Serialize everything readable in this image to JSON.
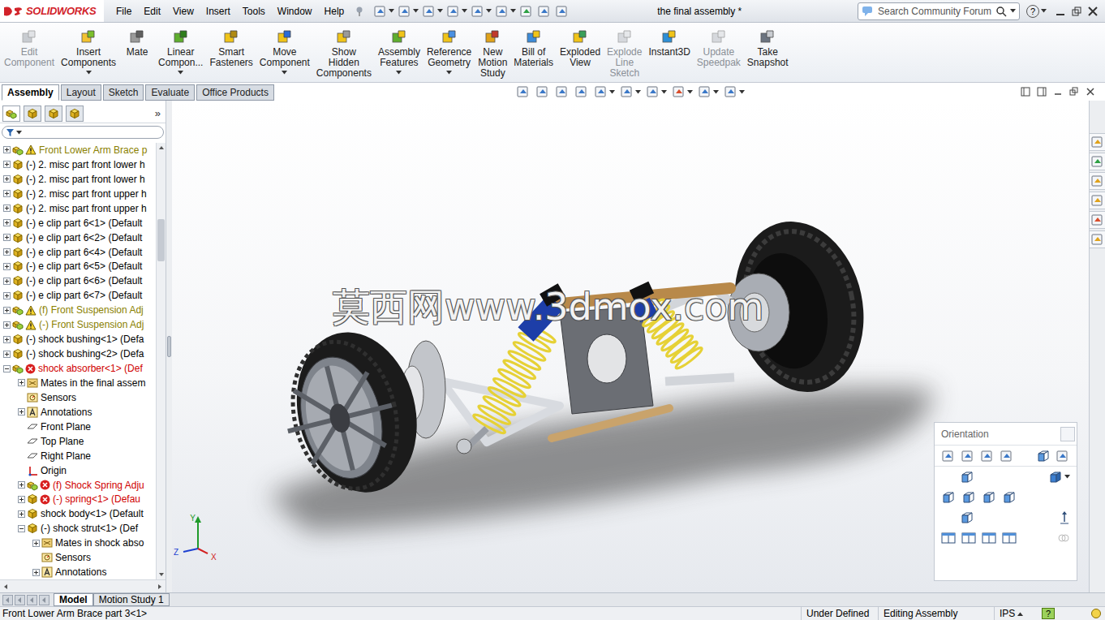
{
  "app": {
    "logo": "SOLIDWORKS",
    "menu": [
      "File",
      "Edit",
      "View",
      "Insert",
      "Tools",
      "Window",
      "Help"
    ],
    "title": "the final assembly *",
    "search": {
      "placeholder": "Search Community Forum"
    },
    "help": "?"
  },
  "command_manager": [
    {
      "lines": [
        "Edit",
        "Component"
      ],
      "disabled": true,
      "dropdown": false
    },
    {
      "lines": [
        "Insert",
        "Components"
      ],
      "disabled": false,
      "dropdown": true
    },
    {
      "lines": [
        "Mate"
      ],
      "disabled": false,
      "dropdown": false
    },
    {
      "lines": [
        "Linear",
        "Compon..."
      ],
      "disabled": false,
      "dropdown": true
    },
    {
      "lines": [
        "Smart",
        "Fasteners"
      ],
      "disabled": false,
      "dropdown": false
    },
    {
      "lines": [
        "Move",
        "Component"
      ],
      "disabled": false,
      "dropdown": true
    },
    {
      "lines": [
        "Show",
        "Hidden",
        "Components"
      ],
      "disabled": false,
      "dropdown": false
    },
    {
      "lines": [
        "Assembly",
        "Features"
      ],
      "disabled": false,
      "dropdown": true
    },
    {
      "lines": [
        "Reference",
        "Geometry"
      ],
      "disabled": false,
      "dropdown": true
    },
    {
      "lines": [
        "New",
        "Motion",
        "Study"
      ],
      "disabled": false,
      "dropdown": false
    },
    {
      "lines": [
        "Bill of",
        "Materials"
      ],
      "disabled": false,
      "dropdown": false
    },
    {
      "lines": [
        "Exploded",
        "View"
      ],
      "disabled": false,
      "dropdown": false
    },
    {
      "lines": [
        "Explode",
        "Line",
        "Sketch"
      ],
      "disabled": true,
      "dropdown": false
    },
    {
      "lines": [
        "Instant3D"
      ],
      "disabled": false,
      "dropdown": false
    },
    {
      "lines": [
        "Update",
        "Speedpak"
      ],
      "disabled": true,
      "dropdown": false
    },
    {
      "lines": [
        "Take",
        "Snapshot"
      ],
      "disabled": false,
      "dropdown": false
    }
  ],
  "command_tabs": [
    {
      "label": "Assembly",
      "selected": true
    },
    {
      "label": "Layout",
      "selected": false
    },
    {
      "label": "Sketch",
      "selected": false
    },
    {
      "label": "Evaluate",
      "selected": false
    },
    {
      "label": "Office Products",
      "selected": false
    }
  ],
  "feature_tree": {
    "more": "»",
    "scroll_position": 0.16,
    "items": [
      {
        "label": "Front Lower Arm Brace p",
        "depth": 0,
        "kind": "assembly",
        "status": "warning",
        "has_children": true,
        "expanded": false
      },
      {
        "label": "(-) 2. misc part front lower h",
        "depth": 0,
        "kind": "part",
        "status": "none",
        "has_children": true,
        "expanded": false
      },
      {
        "label": "(-) 2. misc part front lower h",
        "depth": 0,
        "kind": "part",
        "status": "none",
        "has_children": true,
        "expanded": false
      },
      {
        "label": "(-) 2. misc part front upper h",
        "depth": 0,
        "kind": "part",
        "status": "none",
        "has_children": true,
        "expanded": false
      },
      {
        "label": "(-) 2. misc part front upper h",
        "depth": 0,
        "kind": "part",
        "status": "none",
        "has_children": true,
        "expanded": false
      },
      {
        "label": "(-) e clip part 6<1> (Default",
        "depth": 0,
        "kind": "part",
        "status": "none",
        "has_children": true,
        "expanded": false
      },
      {
        "label": "(-) e clip part 6<2> (Default",
        "depth": 0,
        "kind": "part",
        "status": "none",
        "has_children": true,
        "expanded": false
      },
      {
        "label": "(-) e clip part 6<4> (Default",
        "depth": 0,
        "kind": "part",
        "status": "none",
        "has_children": true,
        "expanded": false
      },
      {
        "label": "(-) e clip part 6<5> (Default",
        "depth": 0,
        "kind": "part",
        "status": "none",
        "has_children": true,
        "expanded": false
      },
      {
        "label": "(-) e clip part 6<6> (Default",
        "depth": 0,
        "kind": "part",
        "status": "none",
        "has_children": true,
        "expanded": false
      },
      {
        "label": "(-) e clip part 6<7> (Default",
        "depth": 0,
        "kind": "part",
        "status": "none",
        "has_children": true,
        "expanded": false
      },
      {
        "label": "(f) Front Suspension Adj",
        "depth": 0,
        "kind": "assembly",
        "status": "warning",
        "has_children": true,
        "expanded": false
      },
      {
        "label": "(-) Front Suspension Adj",
        "depth": 0,
        "kind": "assembly",
        "status": "warning",
        "has_children": true,
        "expanded": false
      },
      {
        "label": "(-) shock bushing<1> (Defa",
        "depth": 0,
        "kind": "part",
        "status": "none",
        "has_children": true,
        "expanded": false
      },
      {
        "label": "(-) shock bushing<2> (Defa",
        "depth": 0,
        "kind": "part",
        "status": "none",
        "has_children": true,
        "expanded": false
      },
      {
        "label": "shock absorber<1> (Def",
        "depth": 0,
        "kind": "assembly",
        "status": "error",
        "has_children": true,
        "expanded": true
      },
      {
        "label": "Mates in the final assem",
        "depth": 1,
        "kind": "mates",
        "status": "none",
        "has_children": true,
        "expanded": false
      },
      {
        "label": "Sensors",
        "depth": 1,
        "kind": "sensors",
        "status": "none",
        "has_children": false,
        "expanded": false
      },
      {
        "label": "Annotations",
        "depth": 1,
        "kind": "annotations",
        "status": "none",
        "has_children": true,
        "expanded": false
      },
      {
        "label": "Front Plane",
        "depth": 1,
        "kind": "plane",
        "status": "none",
        "has_children": false,
        "expanded": false
      },
      {
        "label": "Top Plane",
        "depth": 1,
        "kind": "plane",
        "status": "none",
        "has_children": false,
        "expanded": false
      },
      {
        "label": "Right Plane",
        "depth": 1,
        "kind": "plane",
        "status": "none",
        "has_children": false,
        "expanded": false
      },
      {
        "label": "Origin",
        "depth": 1,
        "kind": "origin",
        "status": "none",
        "has_children": false,
        "expanded": false
      },
      {
        "label": "(f) Shock Spring Adju",
        "depth": 1,
        "kind": "assembly",
        "status": "error",
        "has_children": true,
        "expanded": false
      },
      {
        "label": "(-) spring<1> (Defau",
        "depth": 1,
        "kind": "part",
        "status": "error",
        "has_children": true,
        "expanded": false
      },
      {
        "label": "shock body<1> (Default",
        "depth": 1,
        "kind": "part",
        "status": "none",
        "has_children": true,
        "expanded": false
      },
      {
        "label": "(-) shock strut<1> (Def",
        "depth": 1,
        "kind": "part",
        "status": "none",
        "has_children": true,
        "expanded": true
      },
      {
        "label": "Mates in shock abso",
        "depth": 2,
        "kind": "mates",
        "status": "none",
        "has_children": true,
        "expanded": false
      },
      {
        "label": "Sensors",
        "depth": 2,
        "kind": "sensors",
        "status": "none",
        "has_children": false,
        "expanded": false
      },
      {
        "label": "Annotations",
        "depth": 2,
        "kind": "annotations",
        "status": "none",
        "has_children": true,
        "expanded": false
      }
    ]
  },
  "model_tabs": [
    {
      "label": "Model",
      "selected": true
    },
    {
      "label": "Motion Study 1",
      "selected": false
    }
  ],
  "watermark": "莫西网www.3dmox.com",
  "triad": {
    "y": "Y",
    "x": "X",
    "z": "Z"
  },
  "orientation": {
    "title": "Orientation"
  },
  "status_bar": {
    "message": "Front Lower Arm Brace part 3<1>",
    "items": [
      "Under Defined",
      "Editing Assembly",
      "IPS"
    ],
    "help": "?"
  }
}
